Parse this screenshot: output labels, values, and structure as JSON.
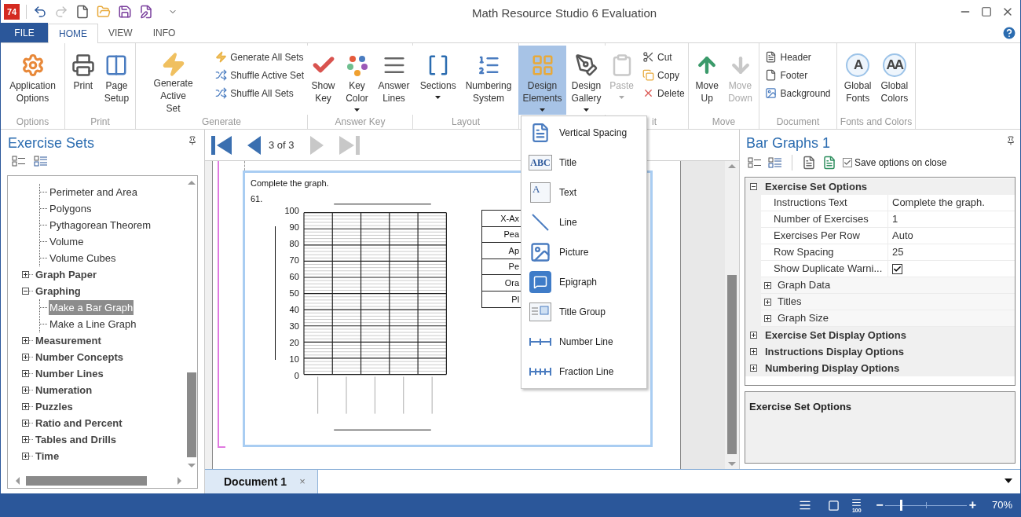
{
  "app": {
    "logo_text": "74",
    "title": "Math Resource Studio 6 Evaluation"
  },
  "quick_access": [
    {
      "disabled": false
    },
    {
      "disabled": true
    },
    {
      "disabled": false
    },
    {
      "disabled": false
    },
    {
      "disabled": false
    },
    {
      "disabled": false
    }
  ],
  "ribbon_tabs": [
    {
      "label": "FILE",
      "kind": "file",
      "selected": false
    },
    {
      "label": "HOME",
      "kind": "tab",
      "selected": true
    },
    {
      "label": "VIEW",
      "kind": "tab",
      "selected": false
    },
    {
      "label": "INFO",
      "kind": "tab",
      "selected": false
    }
  ],
  "ribbon_groups": [
    {
      "label": "Options",
      "buttons": [
        {
          "kind": "large",
          "label": "Application\nOptions",
          "disabled": false,
          "open": false,
          "dropdown": false
        }
      ]
    },
    {
      "label": "Print",
      "buttons": [
        {
          "kind": "large",
          "label": "Print",
          "disabled": false,
          "open": false,
          "dropdown": false
        },
        {
          "kind": "large",
          "label": "Page\nSetup",
          "disabled": false,
          "open": false,
          "dropdown": false
        }
      ]
    },
    {
      "label": "Generate",
      "buttons": [
        {
          "kind": "large",
          "label": "Generate Active\nSet",
          "disabled": false,
          "open": false,
          "dropdown": false
        },
        {
          "kind": "small",
          "label": "Generate All Sets",
          "disabled": false
        },
        {
          "kind": "small",
          "label": "Shuffle Active Set",
          "disabled": false
        },
        {
          "kind": "small",
          "label": "Shuffle All Sets",
          "disabled": false
        }
      ]
    },
    {
      "label": "Answer Key",
      "buttons": [
        {
          "kind": "large",
          "label": "Show\nKey",
          "disabled": false,
          "open": false,
          "dropdown": false
        },
        {
          "kind": "large",
          "label": "Key\nColor",
          "disabled": false,
          "open": false,
          "dropdown": true
        },
        {
          "kind": "large",
          "label": "Answer\nLines",
          "disabled": false,
          "open": false,
          "dropdown": false
        }
      ]
    },
    {
      "label": "Layout",
      "buttons": [
        {
          "kind": "large",
          "label": "Sections",
          "disabled": false,
          "open": false,
          "dropdown": true
        },
        {
          "kind": "large",
          "label": "Numbering\nSystem",
          "disabled": false,
          "open": false,
          "dropdown": false
        }
      ]
    },
    {
      "buttons": [
        {
          "kind": "large",
          "label": "Design\nElements",
          "disabled": false,
          "open": true,
          "dropdown": true
        },
        {
          "kind": "large",
          "label": "Design\nGallery",
          "disabled": false,
          "open": false,
          "dropdown": true
        }
      ]
    },
    {
      "label": "it",
      "buttons": [
        {
          "kind": "large",
          "label": "Paste",
          "disabled": true,
          "open": false,
          "dropdown": true
        },
        {
          "kind": "small",
          "label": "Cut",
          "disabled": false
        },
        {
          "kind": "small",
          "label": "Copy",
          "disabled": false
        },
        {
          "kind": "small",
          "label": "Delete",
          "disabled": false
        }
      ]
    },
    {
      "label": "Move",
      "buttons": [
        {
          "kind": "large",
          "label": "Move\nUp",
          "disabled": false,
          "open": false,
          "dropdown": false
        },
        {
          "kind": "large",
          "label": "Move\nDown",
          "disabled": true,
          "open": false,
          "dropdown": false
        }
      ]
    },
    {
      "label": "Document",
      "buttons": [
        {
          "kind": "small",
          "label": "Header",
          "disabled": false
        },
        {
          "kind": "small",
          "label": "Footer",
          "disabled": false
        },
        {
          "kind": "small",
          "label": "Background",
          "disabled": false
        }
      ]
    },
    {
      "label": "Fonts and Colors",
      "buttons": [
        {
          "kind": "large",
          "label": "Global\nFonts",
          "icon_text": "A",
          "disabled": false,
          "open": false,
          "dropdown": false
        },
        {
          "kind": "large",
          "label": "Global\nColors",
          "icon_text": "AA",
          "disabled": false,
          "open": false,
          "dropdown": false
        }
      ]
    }
  ],
  "design_elements_menu": [
    {
      "label": "Vertical Spacing"
    },
    {
      "label": "Title",
      "icon_text": "ABC"
    },
    {
      "label": "Text",
      "icon_text": "A"
    },
    {
      "label": "Line"
    },
    {
      "label": "Picture"
    },
    {
      "label": "Epigraph"
    },
    {
      "label": "Title Group"
    },
    {
      "label": "Number Line"
    },
    {
      "label": "Fraction Line"
    }
  ],
  "exercise_sets": {
    "title": "Exercise Sets",
    "tree": [
      {
        "children": [
          {
            "label": "Perimeter and Area",
            "selected": false
          },
          {
            "label": "Polygons",
            "selected": false
          },
          {
            "label": "Pythagorean Theorem",
            "selected": false
          },
          {
            "label": "Volume",
            "selected": false
          },
          {
            "label": "Volume Cubes",
            "selected": false
          }
        ]
      },
      {
        "label": "Graph Paper",
        "expanded": false
      },
      {
        "label": "Graphing",
        "expanded": true,
        "children": [
          {
            "label": "Make a Bar Graph",
            "selected": true
          },
          {
            "label": "Make a Line Graph",
            "selected": false
          }
        ]
      },
      {
        "label": "Measurement",
        "expanded": false
      },
      {
        "label": "Number Concepts",
        "expanded": false
      },
      {
        "label": "Number Lines",
        "expanded": false
      },
      {
        "label": "Numeration",
        "expanded": false
      },
      {
        "label": "Puzzles",
        "expanded": false
      },
      {
        "label": "Ratio and Percent",
        "expanded": false
      },
      {
        "label": "Tables and Drills",
        "expanded": false
      },
      {
        "label": "Time",
        "expanded": false
      }
    ]
  },
  "navigator": {
    "page": "3 of 3",
    "back_enabled": true,
    "forward_enabled": false
  },
  "worksheet": {
    "instructions": "Complete the graph.",
    "number": "61.",
    "y_labels": [
      "100",
      "90",
      "80",
      "70",
      "60",
      "50",
      "40",
      "30",
      "20",
      "10",
      "0"
    ],
    "table_rows": [
      "X-Ax",
      "Pea",
      "Ap",
      "Pe",
      "Ora",
      "Pl"
    ]
  },
  "document_tabs": [
    {
      "label": "Document 1",
      "selected": true,
      "close": "×"
    }
  ],
  "options_panel": {
    "title": "Bar Graphs 1",
    "save_on_close": {
      "label": "Save options on close",
      "checked": true
    },
    "categories": [
      {
        "label": "Exercise Set Options",
        "expanded": true,
        "items": [
          {
            "kind": "text",
            "name": "Instructions Text",
            "value": "Complete the graph."
          },
          {
            "kind": "text",
            "name": "Number of Exercises",
            "value": "1"
          },
          {
            "kind": "text",
            "name": "Exercises Per Row",
            "value": "Auto"
          },
          {
            "kind": "text",
            "name": "Row Spacing",
            "value": "25"
          },
          {
            "kind": "checkbox",
            "name": "Show Duplicate Warni...",
            "checked": true
          },
          {
            "kind": "group",
            "label": "Graph Data",
            "expanded": false
          },
          {
            "kind": "group",
            "label": "Titles",
            "expanded": false
          },
          {
            "kind": "group",
            "label": "Graph Size",
            "expanded": false
          }
        ]
      },
      {
        "label": "Exercise Set Display Options",
        "expanded": false
      },
      {
        "label": "Instructions Display Options",
        "expanded": false
      },
      {
        "label": "Numbering Display Options",
        "expanded": false
      }
    ],
    "description": {
      "title": "Exercise Set Options"
    }
  },
  "status_bar": {
    "actual_size_label": "100",
    "zoom_out": "−",
    "zoom_in": "+",
    "zoom": {
      "level": 0.2
    },
    "zoom_text": "70%"
  }
}
